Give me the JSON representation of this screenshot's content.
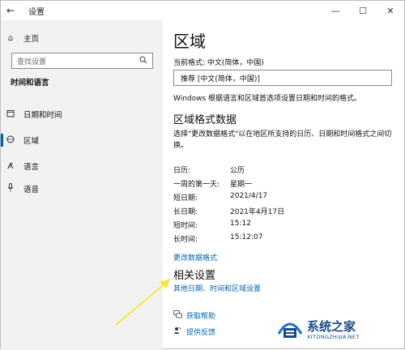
{
  "window": {
    "app_title": "设置",
    "back_glyph": "←",
    "minimize_glyph": "—",
    "maximize_glyph": "☐",
    "close_glyph": "✕"
  },
  "sidebar": {
    "home_label": "主页",
    "search_placeholder": "查找设置",
    "section_title": "时间和语言",
    "items": [
      {
        "label": "日期和时间",
        "icon": "calendar-clock-icon"
      },
      {
        "label": "区域",
        "icon": "globe-icon"
      },
      {
        "label": "语言",
        "icon": "language-icon"
      },
      {
        "label": "语音",
        "icon": "microphone-icon"
      }
    ]
  },
  "main": {
    "title": "区域",
    "current_format_label": "当前格式: 中文(简体，中国)",
    "recommended_value": "推荐 [中文(简体，中国)]",
    "windows_note": "Windows 根据语言和区域首选项设置日期和时间的格式。",
    "regional_data_title": "区域格式数据",
    "regional_data_desc": "选择\"更改数据格式\"以在地区所支持的日历、日期和时间格式之间切换。",
    "rows": [
      {
        "key": "日历:",
        "value": "公历"
      },
      {
        "key": "一周的第一天:",
        "value": "星期一"
      },
      {
        "key": "短日期:",
        "value": "2021/4/17"
      },
      {
        "key": "长日期:",
        "value": "2021年4月17日"
      },
      {
        "key": "短时间:",
        "value": "15:12"
      },
      {
        "key": "长时间:",
        "value": "15:12:07"
      }
    ],
    "change_format_link": "更改数据格式",
    "related_title": "相关设置",
    "related_link": "其他日期、时间和区域设置",
    "help_link": "获取帮助",
    "feedback_link": "提供反馈"
  },
  "watermark": {
    "brand": "系统之家",
    "domain": "XITONGZHIJIA.NET"
  },
  "colors": {
    "accent": "#0063b1",
    "arrow": "#f5e642",
    "sidebar_bg": "#f2f2f2"
  }
}
